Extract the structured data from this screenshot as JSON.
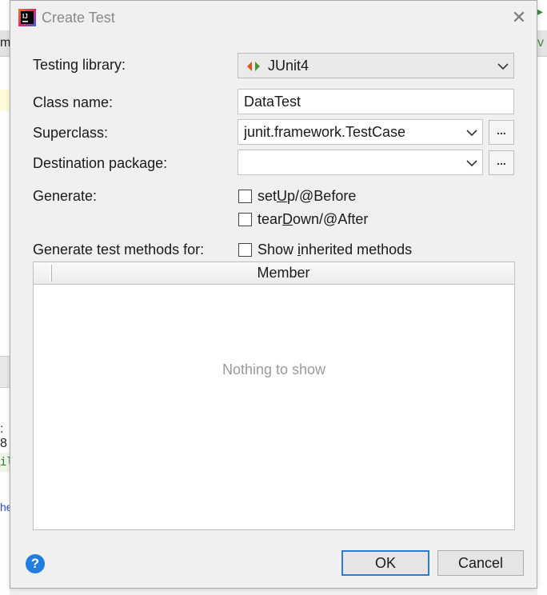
{
  "background": {
    "left_strip1_text": "m",
    "left_t1": ": 8",
    "left_t2": "il",
    "left_t3": "he",
    "right_strip1_text": "v",
    "right_top_text": "▸"
  },
  "dialog": {
    "title": "Create Test",
    "close_glyph": "✕",
    "labels": {
      "testing_library": "Testing library:",
      "class_name": "Class name:",
      "superclass": "Superclass:",
      "destination_package": "Destination package:",
      "generate": "Generate:",
      "generate_methods_for": "Generate test methods for:"
    },
    "testing_library_value": "JUnit4",
    "class_name_value": "DataTest",
    "superclass_value": "junit.framework.TestCase",
    "destination_package_value": "",
    "browse_label": "...",
    "generate_options": [
      {
        "pre": "set",
        "mnemonic": "U",
        "post": "p/@Before",
        "checked": false
      },
      {
        "pre": "tear",
        "mnemonic": "D",
        "post": "own/@After",
        "checked": false
      }
    ],
    "show_inherited": {
      "pre": "Show ",
      "mnemonic": "i",
      "post": "nherited methods",
      "checked": false
    },
    "table": {
      "column_header": "Member",
      "empty_text": "Nothing to show"
    },
    "help_glyph": "?",
    "ok_label": "OK",
    "cancel_label": "Cancel"
  },
  "colors": {
    "accent": "#2e7bd6",
    "junit_left": "#e0531f",
    "junit_right": "#3f9c35"
  }
}
